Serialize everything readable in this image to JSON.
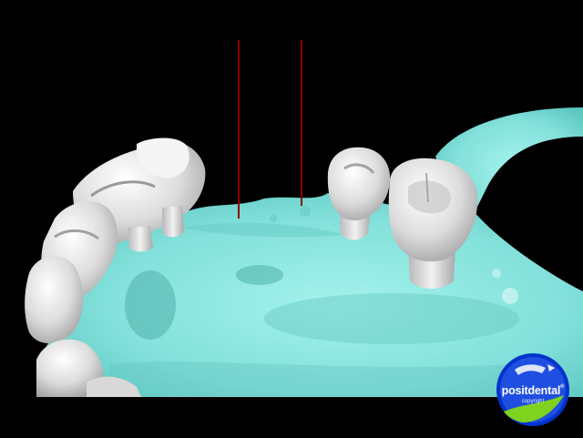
{
  "scene": {
    "background_color": "#000000",
    "bone_color": "#8ee8e2",
    "tooth_color": "#e8e8e8",
    "guide_line_color": "#8b0000"
  },
  "logo": {
    "brand": "positdental",
    "trademark": "®",
    "subtitle": "copyright",
    "ring_color": "#0033cc",
    "fill_color": "#1f4fe0",
    "accent_color": "#7fd21e"
  }
}
